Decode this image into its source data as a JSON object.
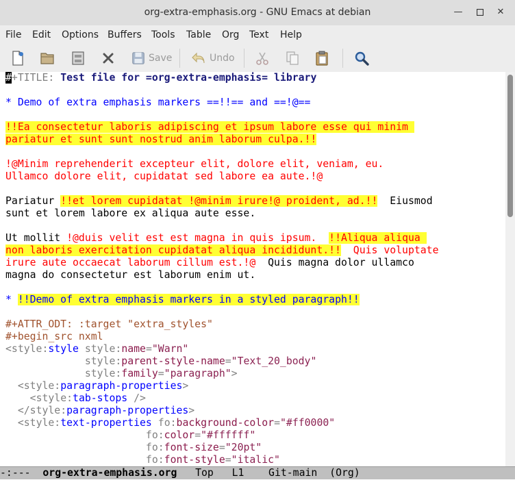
{
  "window": {
    "title": "org-extra-emphasis.org - GNU Emacs at debian"
  },
  "menubar": {
    "items": [
      "File",
      "Edit",
      "Options",
      "Buffers",
      "Tools",
      "Table",
      "Org",
      "Text",
      "Help"
    ]
  },
  "toolbar": {
    "save_label": "Save",
    "undo_label": "Undo"
  },
  "buffer": {
    "title_line": {
      "cursor_char": "#",
      "keyword_rest": "+TITLE:",
      "value": "Test file for =org-extra-emphasis= library"
    },
    "heading1": {
      "star": "*",
      "text": " Demo of extra emphasis markers ==!!== and ==!@=="
    },
    "para1": [
      "!!Ea consectetur laboris adipiscing et ipsum labore esse qui minim ",
      "pariatur et sunt sunt nostrud anim laborum culpa.!!"
    ],
    "para2": [
      "!@Minim reprehenderit excepteur elit, dolore elit, veniam, eu.",
      "Ullamco dolore elit, cupidatat sed labore ea aute.!@"
    ],
    "para3": {
      "l1_a": "Pariatur ",
      "l1_b": "!!et lorem cupidatat ",
      "l1_c": "!@minim irure!@",
      "l1_d": " proident, ad.!!",
      "l1_e": "  Eiusmod",
      "l2": "sunt et lorem labore ex aliqua aute esse."
    },
    "para4": {
      "l1_a": "Ut mollit ",
      "l1_b": "!@duis velit est est magna in quis ipsum.",
      "l1_c": "  ",
      "l1_d": "!!Aliqua aliqua ",
      "l2_a": "non laboris exercitation cupidatat aliqua incididunt.!!",
      "l2_b": "  Quis voluptate",
      "l3_a": "irure aute occaecat laborum cillum est.!@",
      "l3_b": "  Quis magna dolor ullamco",
      "l4": "magna do consectetur est laborum enim ut."
    },
    "heading2": {
      "star": "* ",
      "text": "!!Demo of extra emphasis markers in a styled paragraph!!"
    },
    "attr_line": "#+ATTR_ODT: :target \"extra_styles\"",
    "begin_src": "#+begin_src nxml",
    "xml": {
      "l1_open": "<",
      "l1_ns": "style",
      "l1_colon": ":",
      "l1_tag": "style",
      "l1_sp": " ",
      "l1_attns": "style",
      "l1_attr": "name",
      "l1_eq": "=",
      "l1_val": "\"Warn\"",
      "l2_ind": "             ",
      "l2_attns": "style",
      "l2_attr": "parent-style-name",
      "l2_val": "\"Text_20_body\"",
      "l3_ind": "             ",
      "l3_attns": "style",
      "l3_attr": "family",
      "l3_val": "\"paragraph\"",
      "l3_close": ">",
      "l4_ind": "  ",
      "l4_ns": "style",
      "l4_tag": "paragraph-properties",
      "l5_ind": "    ",
      "l5_ns": "style",
      "l5_tag": "tab-stops",
      "l5_close": " />",
      "l6_ind": "  ",
      "l6_open": "</",
      "l6_ns": "style",
      "l6_tag": "paragraph-properties",
      "l7_ind": "  ",
      "l7_ns": "style",
      "l7_tag": "text-properties",
      "l7_attns": "fo",
      "l7_attr": "background-color",
      "l7_val": "\"#ff0000\"",
      "l8_ind": "                       ",
      "l8_attns": "fo",
      "l8_attr": "color",
      "l8_val": "\"#ffffff\"",
      "l9_ind": "                       ",
      "l9_attns": "fo",
      "l9_attr": "font-size",
      "l9_val": "\"20pt\"",
      "l10_ind": "                       ",
      "l10_attns": "fo",
      "l10_attr": "font-style",
      "l10_val": "\"italic\""
    }
  },
  "modeline": {
    "text": "-:---  org-extra-emphasis.org   Top   L1    Git-main  (Org)",
    "status": "-:---",
    "buffer_name": "org-extra-emphasis.org",
    "position": "Top",
    "line": "L1",
    "vc": "Git-main",
    "mode": "(Org)"
  },
  "colors": {
    "highlight": "#ffff33",
    "red_emphasis": "#ff0000",
    "heading_blue": "#0000ff",
    "title_navy": "#1a1a7a"
  }
}
